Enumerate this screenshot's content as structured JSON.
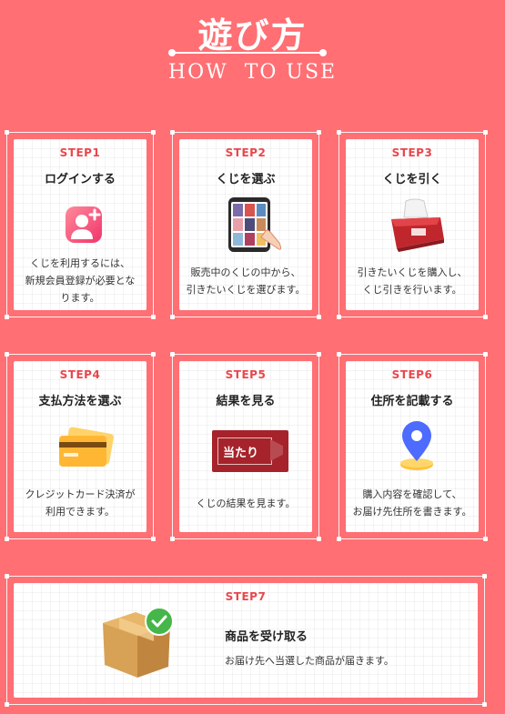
{
  "header": {
    "title": "遊び方",
    "subtitle": "HOW  TO USE"
  },
  "steps": [
    {
      "step": "STEP1",
      "title": "ログインする",
      "desc": [
        "くじを利用するには、",
        "新規会員登録が必要とな",
        "ります。"
      ],
      "icon": "user-add-icon"
    },
    {
      "step": "STEP2",
      "title": "くじを選ぶ",
      "desc": [
        "販売中のくじの中から、",
        "引きたいくじを選びます。"
      ],
      "icon": "phone-select-icon"
    },
    {
      "step": "STEP3",
      "title": "くじを引く",
      "desc": [
        "引きたいくじを購入し、",
        "くじ引きを行います。"
      ],
      "icon": "lottery-box-icon"
    },
    {
      "step": "STEP4",
      "title": "支払方法を選ぶ",
      "desc": [
        "クレジットカード決済が",
        "利用できます。"
      ],
      "icon": "credit-card-icon"
    },
    {
      "step": "STEP5",
      "title": "結果を見る",
      "desc": [
        "くじの結果を見ます。"
      ],
      "icon": "winning-ticket-icon"
    },
    {
      "step": "STEP6",
      "title": "住所を記載する",
      "desc": [
        "購入内容を確認して、",
        "お届け先住所を書きます。"
      ],
      "icon": "location-pin-icon"
    },
    {
      "step": "STEP7",
      "title": "商品を受け取る",
      "desc": [
        "お届け先へ当選した商品が届きます。"
      ],
      "icon": "package-delivered-icon"
    }
  ],
  "ticket_text": "当たり",
  "colors": {
    "background": "#FF6F73",
    "accent": "#E8474D",
    "card": "#FFFFFF"
  }
}
